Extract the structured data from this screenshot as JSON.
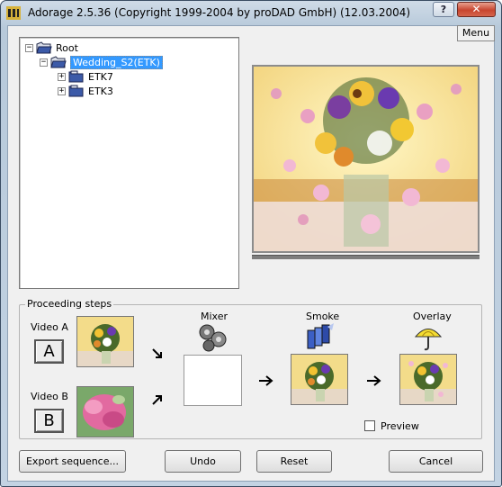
{
  "window": {
    "title": "Adorage 2.5.36  (Copyright 1999-2004 by proDAD GmbH)  (12.03.2004)",
    "help_label": "?",
    "close_label": "✕",
    "menu_label": "Menu"
  },
  "tree": {
    "root": "Root",
    "selected": "Wedding_S2(ETK)",
    "children": [
      "ETK7",
      "ETK3"
    ],
    "expander_minus": "−",
    "expander_plus": "+"
  },
  "steps": {
    "group_title": "Proceeding steps",
    "video_a_label": "Video A",
    "video_a_letter": "A",
    "video_b_label": "Video B",
    "video_b_letter": "B",
    "mixer_label": "Mixer",
    "smoke_label": "Smoke",
    "overlay_label": "Overlay",
    "preview_label": "Preview",
    "preview_checked": false
  },
  "buttons": {
    "export": "Export sequence...",
    "undo": "Undo",
    "reset": "Reset",
    "cancel": "Cancel"
  },
  "colors": {
    "selection": "#3399ff",
    "client_bg": "#f0f0f0",
    "close_red": "#c8452f"
  }
}
